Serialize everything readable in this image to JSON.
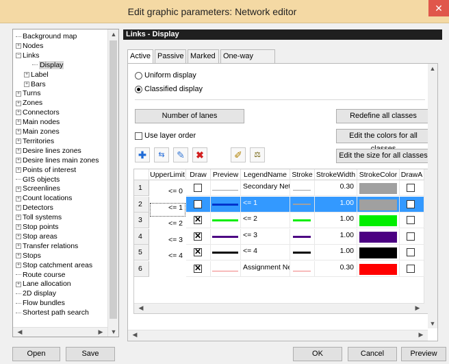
{
  "window": {
    "title": "Edit graphic parameters: Network editor",
    "close_glyph": "✕"
  },
  "tree": {
    "items": [
      {
        "label": "Background map",
        "exp": ""
      },
      {
        "label": "Nodes",
        "exp": "+"
      },
      {
        "label": "Links",
        "exp": "−"
      },
      {
        "label": "Display",
        "exp": "",
        "selected": true
      },
      {
        "label": "Label",
        "exp": "+"
      },
      {
        "label": "Bars",
        "exp": "+"
      },
      {
        "label": "Turns",
        "exp": "+"
      },
      {
        "label": "Zones",
        "exp": "+"
      },
      {
        "label": "Connectors",
        "exp": "+"
      },
      {
        "label": "Main nodes",
        "exp": "+"
      },
      {
        "label": "Main zones",
        "exp": "+"
      },
      {
        "label": "Territories",
        "exp": "+"
      },
      {
        "label": "Desire lines zones",
        "exp": "+"
      },
      {
        "label": "Desire lines main zones",
        "exp": "+"
      },
      {
        "label": "Points of interest",
        "exp": "+"
      },
      {
        "label": "GIS objects",
        "exp": ""
      },
      {
        "label": "Screenlines",
        "exp": "+"
      },
      {
        "label": "Count locations",
        "exp": "+"
      },
      {
        "label": "Detectors",
        "exp": "+"
      },
      {
        "label": "Toll systems",
        "exp": "+"
      },
      {
        "label": "Stop points",
        "exp": "+"
      },
      {
        "label": "Stop areas",
        "exp": "+"
      },
      {
        "label": "Transfer relations",
        "exp": "+"
      },
      {
        "label": "Stops",
        "exp": "+"
      },
      {
        "label": "Stop catchment areas",
        "exp": "+"
      },
      {
        "label": "Route course",
        "exp": ""
      },
      {
        "label": "Lane allocation",
        "exp": "+"
      },
      {
        "label": "2D display",
        "exp": ""
      },
      {
        "label": "Flow bundles",
        "exp": ""
      },
      {
        "label": "Shortest path search",
        "exp": ""
      }
    ]
  },
  "panel": {
    "title": "Links - Display"
  },
  "tabs": [
    "Active",
    "Passive",
    "Marked",
    "One-way roads"
  ],
  "display_mode": {
    "uniform": "Uniform display",
    "classified": "Classified display",
    "selected": "classified"
  },
  "buttons": {
    "number_of_lanes": "Number of lanes",
    "redefine_all": "Redefine all classes",
    "edit_colors": "Edit the colors for all classes",
    "edit_size": "Edit the size for all classes",
    "use_layer_order": "Use layer order"
  },
  "toolbar_icons": [
    "add-icon",
    "convert-icon",
    "pencil-icon",
    "delete-icon",
    "edit-box-icon",
    "scale-icon"
  ],
  "grid": {
    "columns": [
      "UpperLimit",
      "Draw",
      "Preview",
      "LegendName",
      "Stroke",
      "StrokeWidth",
      "StrokeColor",
      "DrawA"
    ],
    "upper_limits": [
      "<= 0",
      "<= 1",
      "<= 2",
      "<= 3",
      "<= 4"
    ],
    "rows": [
      {
        "num": "1",
        "draw": false,
        "legend": "Secondary Net",
        "width": "0.30",
        "color": "#a0a0a0",
        "line_color": "#a0a0a0",
        "line_w": 1
      },
      {
        "num": "2",
        "draw": false,
        "legend": "<= 1",
        "width": "1.00",
        "color": "#a0a0a0",
        "line_color": "#0033cc",
        "line_w": 3,
        "selected": true
      },
      {
        "num": "3",
        "draw": true,
        "legend": "<= 2",
        "width": "1.00",
        "color": "#00ee00",
        "line_color": "#00ee00",
        "line_w": 3
      },
      {
        "num": "4",
        "draw": true,
        "legend": "<= 3",
        "width": "1.00",
        "color": "#4b0082",
        "line_color": "#4b0082",
        "line_w": 3
      },
      {
        "num": "5",
        "draw": true,
        "legend": "<= 4",
        "width": "1.00",
        "color": "#000000",
        "line_color": "#000000",
        "line_w": 3
      },
      {
        "num": "6",
        "draw": true,
        "legend": "Assignment Ne",
        "width": "0.30",
        "color": "#ff0000",
        "line_color": "#f08080",
        "line_w": 1
      }
    ]
  },
  "footer": {
    "open": "Open",
    "save": "Save",
    "ok": "OK",
    "cancel": "Cancel",
    "preview": "Preview"
  }
}
